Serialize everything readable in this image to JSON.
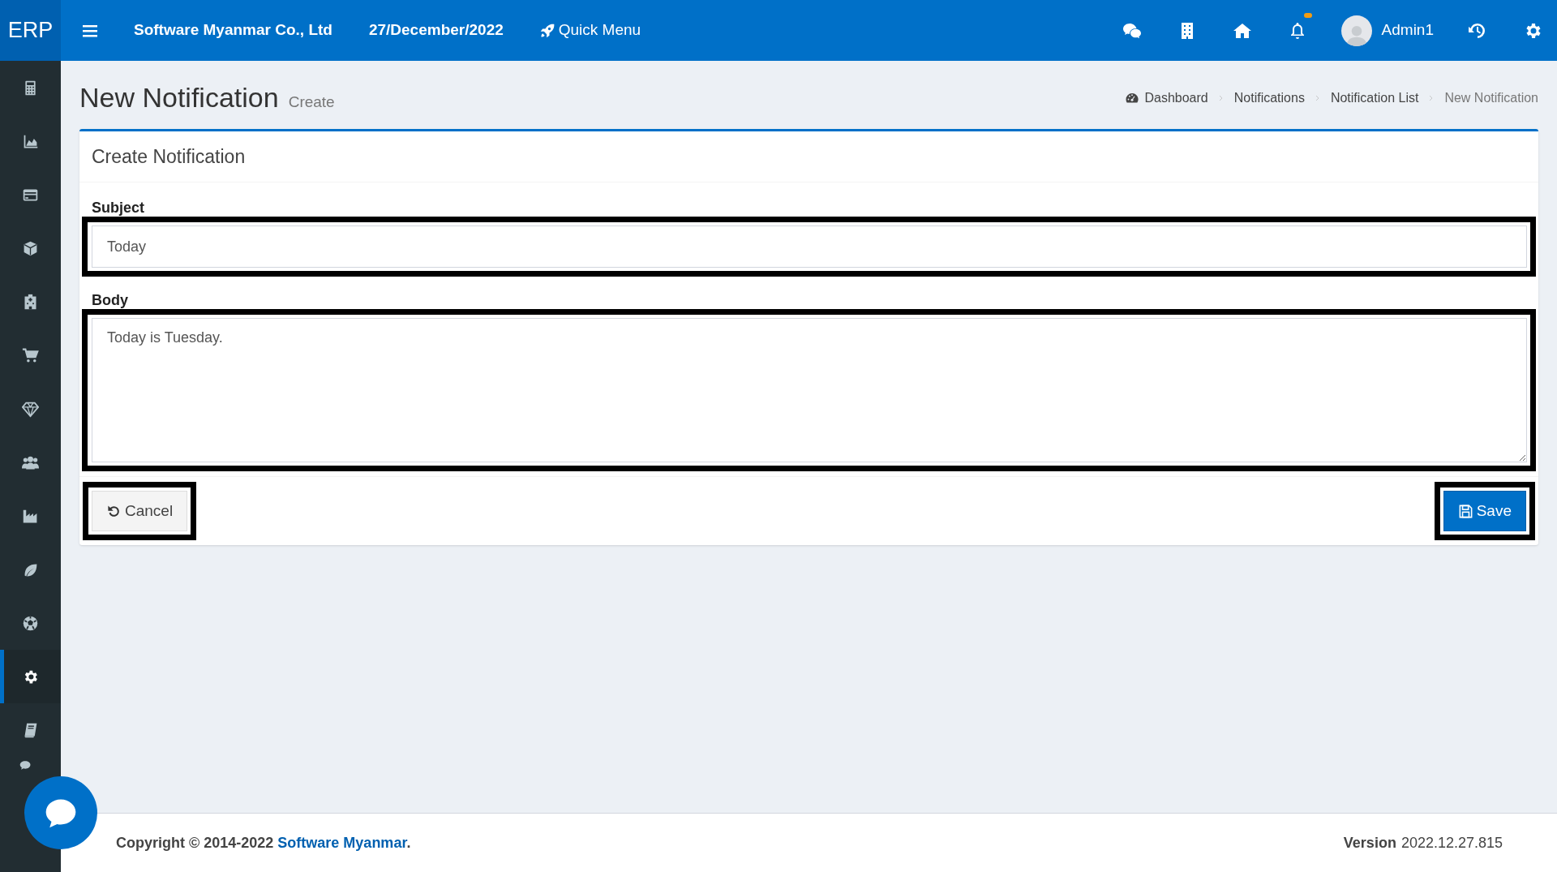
{
  "header": {
    "logo": "ERP",
    "company": "Software Myanmar Co., Ltd",
    "date": "27/December/2022",
    "quick_menu": "Quick Menu",
    "user": "Admin1"
  },
  "sidebar": {
    "items": [
      {
        "selected": false
      },
      {
        "selected": false
      },
      {
        "selected": false
      },
      {
        "selected": false
      },
      {
        "selected": false
      },
      {
        "selected": false
      },
      {
        "selected": false
      },
      {
        "selected": false
      },
      {
        "selected": false
      },
      {
        "selected": false
      },
      {
        "selected": false
      },
      {
        "selected": true
      },
      {
        "selected": false
      },
      {
        "selected": false
      }
    ]
  },
  "page": {
    "title": "New Notification",
    "subtitle": "Create"
  },
  "breadcrumb": [
    "Dashboard",
    "Notifications",
    "Notification List",
    "New Notification"
  ],
  "card": {
    "title": "Create Notification",
    "fields": [
      {
        "kind": "input",
        "label": "Subject",
        "value": "Today"
      },
      {
        "kind": "textarea",
        "label": "Body",
        "value": "Today is Tuesday."
      }
    ],
    "buttons": [
      {
        "kind": "cancel",
        "label": "Cancel"
      },
      {
        "kind": "save",
        "label": "Save"
      }
    ]
  },
  "footer": {
    "copyright": "Copyright © 2014-2022 ",
    "company_link": "Software Myanmar",
    "period": ".",
    "version_label": "Version",
    "version": "2022.12.27.815"
  }
}
